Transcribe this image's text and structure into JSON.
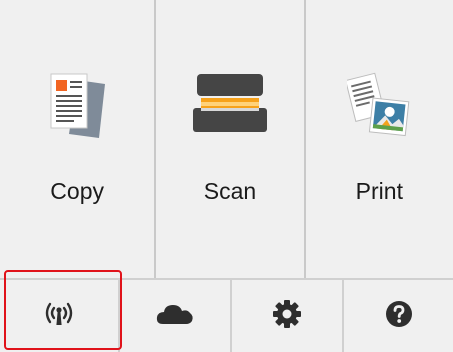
{
  "tiles": [
    {
      "id": "copy",
      "label": "Copy",
      "icon": "copy-document-icon"
    },
    {
      "id": "scan",
      "label": "Scan",
      "icon": "scanner-icon"
    },
    {
      "id": "print",
      "label": "Print",
      "icon": "print-photo-icon"
    }
  ],
  "bottom_bar": [
    {
      "id": "wireless",
      "icon": "wireless-lan-icon",
      "glyph": "((ı))"
    },
    {
      "id": "cloud",
      "icon": "cloud-icon"
    },
    {
      "id": "settings",
      "icon": "gear-icon"
    },
    {
      "id": "help",
      "icon": "question-mark-icon",
      "glyph": "?"
    }
  ],
  "colors": {
    "background": "#f0f0f0",
    "icon_dark": "#3a3a3a",
    "highlight": "#e0121a",
    "copy_accent": "#f26522"
  }
}
